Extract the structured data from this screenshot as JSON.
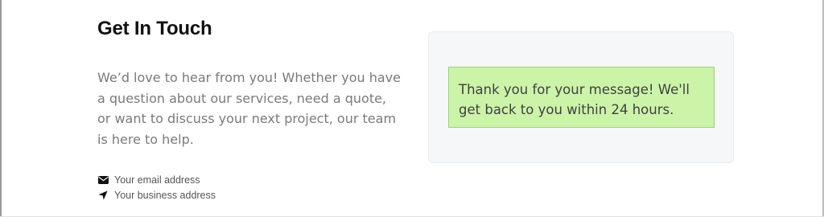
{
  "contact": {
    "title": "Get In Touch",
    "intro": "We’d love to hear from you! Whether you have a question about our services, need a quote, or want to discuss your next project, our team is here to help.",
    "email_label": "Your email address",
    "address_label": "Your business address",
    "email_icon": "envelope-icon",
    "address_icon": "location-arrow-icon"
  },
  "form_card": {
    "success_message": "Thank you for your message! We'll get back to you within 24 hours."
  },
  "colors": {
    "success_bg": "#ccf4a9",
    "success_border": "#9fd07c",
    "card_bg": "#f6f7f9",
    "heading": "#111111",
    "body_text": "#7a7a7a"
  }
}
